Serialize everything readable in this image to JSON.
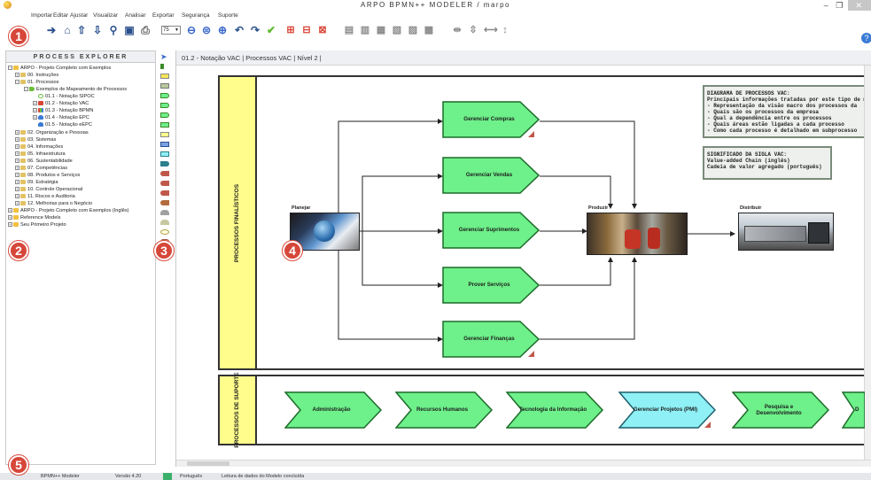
{
  "window": {
    "title": "ARPO BPMN++ MODELER / marpo",
    "minimize": "–",
    "maximize": "❐",
    "close": "✕"
  },
  "menu": [
    "Importar",
    "Editar",
    "Ajustar",
    "Visualizar",
    "Analisar",
    "Exportar",
    "Segurança",
    "Suporte"
  ],
  "toolbar": {
    "zoom_value": "75"
  },
  "explorer": {
    "header": "PROCESS EXPLORER",
    "items": [
      "ARPO - Projeto Completo com Exemplos",
      "00. Instruções",
      "01. Processos",
      "Exemplos de Mapeamento de Processos",
      "01.1 - Notação SIPOC",
      "01.2 - Notação VAC",
      "01.3 - Notação BPMN",
      "01.4 - Notação EPC",
      "01.5 - Notação eEPC",
      "02. Organização e Pessoas",
      "03. Sistemas",
      "04. Informações",
      "05. Infraestrutura",
      "06. Sustentabilidade",
      "07. Competências",
      "08. Produtos e Serviços",
      "09. Estratégia",
      "10. Controle Operacional",
      "11. Riscos e Auditoria",
      "12. Melhorias para o Negócio",
      "ARPO - Projeto Completo com Exemplos (Inglês)",
      "Reference Models",
      "Seu Primeiro Projeto"
    ]
  },
  "canvas": {
    "breadcrumb": "01.2 - Notação VAC   |   Processos VAC   |   Nível 2   |",
    "pool_finalistic": "PROCESSOS FINALÍSTICOS",
    "pool_support": "PROCESSOS DE SUPORTE",
    "main_processes": [
      "Gerenciar Compras",
      "Gerenciar Vendas",
      "Gerenciar Suprimentos",
      "Prover Serviços",
      "Gerenciar Finanças"
    ],
    "photo_labels": [
      "Planejar",
      "Produzir",
      "Distribuir"
    ],
    "support_processes": [
      "Administração",
      "Recursos Humanos",
      "Tecnologia da Informação",
      "Gerenciar Projetos (PMI)",
      "Pesquisa e Desenvolvimento",
      "D"
    ],
    "note1": [
      "DIAGRAMA DE PROCESSOS VAC:",
      "Principais informações tratadas por este tipo de m",
      "- Representação da visão macro dos processos da",
      "- Quais são os processos da empresa",
      "- Qual a dependência entre os processos",
      "- Quais áreas estão ligadas a cada processo",
      "- Como cada processo é detalhado em subprocesso"
    ],
    "note2": [
      "SIGNIFICADO DA SIGLA VAC:",
      "Value-added Chain (inglês)",
      "Cadeia de valor agregado (português)"
    ]
  },
  "badges": [
    "1",
    "2",
    "3",
    "4",
    "5"
  ],
  "status": {
    "app": "BPMN++ Modeler",
    "version": "Versão 4.20",
    "language": "Português",
    "message": "Leitura de dados do Modelo concluída"
  },
  "colors": {
    "process_fill": "#6ef08a",
    "highlight_fill": "#8ff0f5",
    "pool_label": "#fffd8c",
    "badge": "#d6473a"
  }
}
